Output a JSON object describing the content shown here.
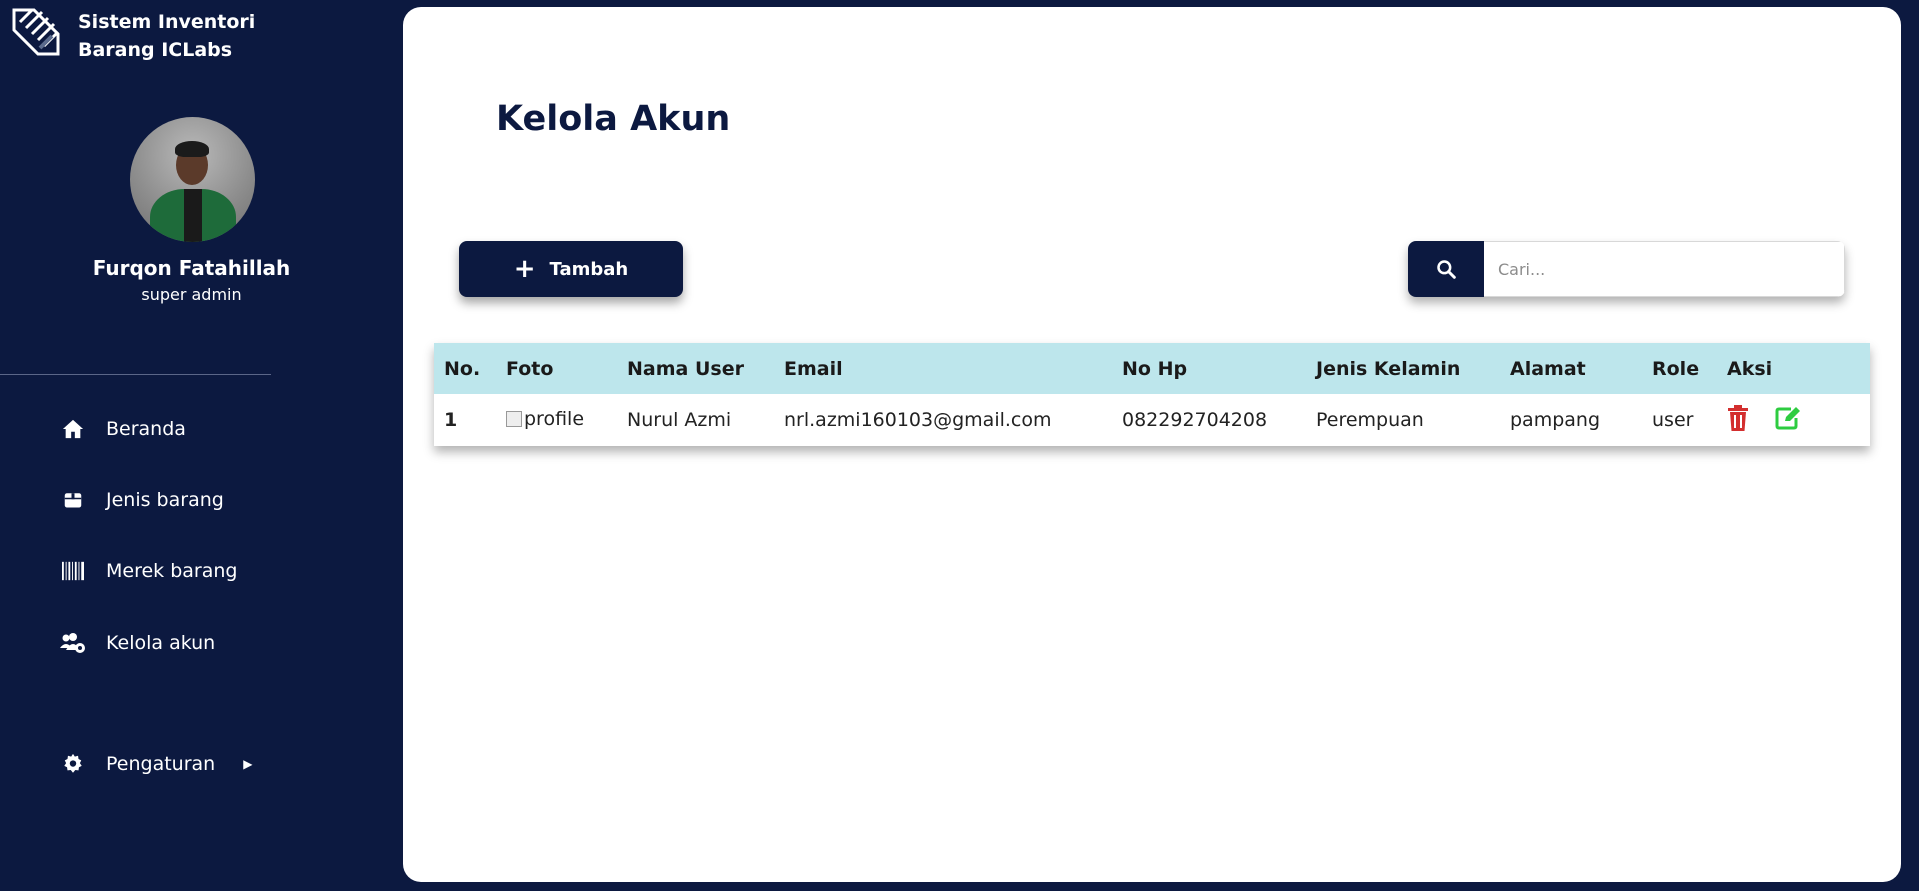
{
  "app": {
    "title": "Sistem Inventori Barang ICLabs"
  },
  "user": {
    "name": "Furqon Fatahillah",
    "role": "super admin"
  },
  "sidebar": {
    "items": [
      {
        "label": "Beranda",
        "icon": "home-icon"
      },
      {
        "label": "Jenis barang",
        "icon": "box-icon"
      },
      {
        "label": "Merek barang",
        "icon": "barcode-icon"
      },
      {
        "label": "Kelola akun",
        "icon": "users-gear-icon"
      },
      {
        "label": "Pengaturan",
        "icon": "gear-icon"
      }
    ]
  },
  "main": {
    "title": "Kelola Akun",
    "add_label": "Tambah",
    "search_placeholder": "Cari...",
    "table": {
      "headers": [
        "No.",
        "Foto",
        "Nama User",
        "Email",
        "No Hp",
        "Jenis Kelamin",
        "Alamat",
        "Role",
        "Aksi"
      ],
      "rows": [
        {
          "no": "1",
          "foto_alt": "profile",
          "nama": "Nurul Azmi",
          "email": "nrl.azmi160103@gmail.com",
          "hp": "082292704208",
          "jk": "Perempuan",
          "alamat": "pampang",
          "role": "user"
        }
      ]
    }
  },
  "colors": {
    "primary": "#0c1940",
    "table_header": "#bde6ec",
    "delete": "#d32f2f",
    "edit": "#2ecc40"
  }
}
